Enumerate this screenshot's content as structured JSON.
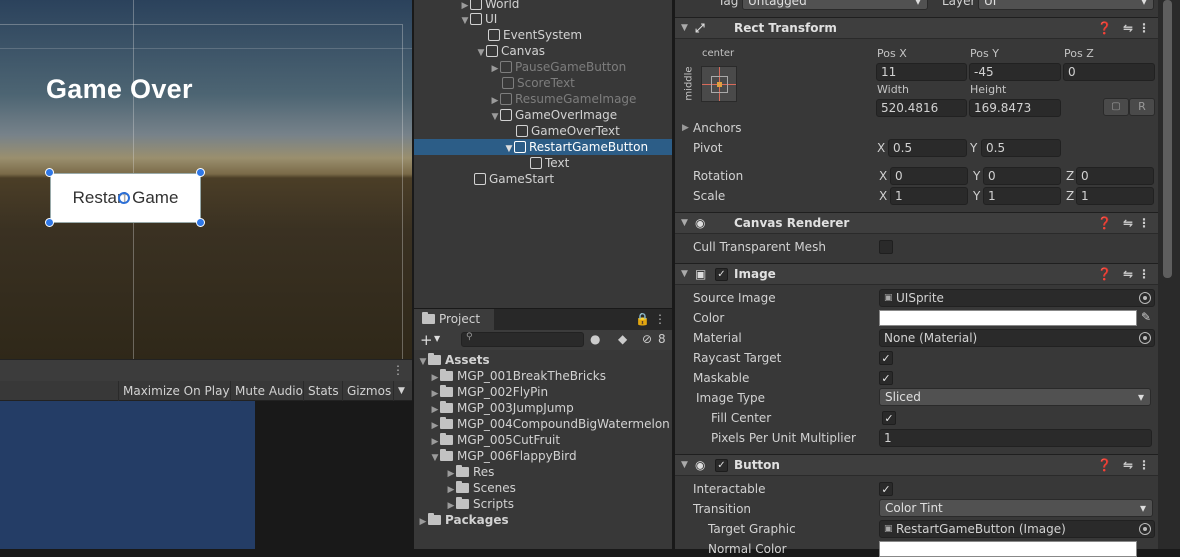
{
  "scene": {
    "title_text": "Game Over",
    "button_text": "Restart Game"
  },
  "game_toolbar": {
    "maximize_label": "Maximize On Play",
    "mute_label": "Mute Audio",
    "stats_label": "Stats",
    "gizmos_label": "Gizmos"
  },
  "hierarchy": {
    "items": [
      {
        "label": "World"
      },
      {
        "label": "UI"
      },
      {
        "label": "EventSystem"
      },
      {
        "label": "Canvas"
      },
      {
        "label": "PauseGameButton"
      },
      {
        "label": "ScoreText"
      },
      {
        "label": "ResumeGameImage"
      },
      {
        "label": "GameOverImage"
      },
      {
        "label": "GameOverText"
      },
      {
        "label": "RestartGameButton"
      },
      {
        "label": "Text"
      },
      {
        "label": "GameStart"
      }
    ]
  },
  "project": {
    "tab_label": "Project",
    "hidden_count": "8",
    "items": [
      {
        "label": "Assets"
      },
      {
        "label": "MGP_001BreakTheBricks"
      },
      {
        "label": "MGP_002FlyPin"
      },
      {
        "label": "MGP_003JumpJump"
      },
      {
        "label": "MGP_004CompoundBigWatermelon"
      },
      {
        "label": "MGP_005CutFruit"
      },
      {
        "label": "MGP_006FlappyBird"
      },
      {
        "label": "Res"
      },
      {
        "label": "Scenes"
      },
      {
        "label": "Scripts"
      },
      {
        "label": "Packages"
      }
    ]
  },
  "inspector": {
    "tag_label": "Tag",
    "tag_value": "Untagged",
    "layer_label": "Layer",
    "layer_value": "UI",
    "rect_transform": {
      "title": "Rect Transform",
      "anchor_h": "center",
      "anchor_v": "middle",
      "pos_x_label": "Pos X",
      "pos_x": "11",
      "pos_y_label": "Pos Y",
      "pos_y": "-45",
      "pos_z_label": "Pos Z",
      "pos_z": "0",
      "width_label": "Width",
      "width": "520.4816",
      "height_label": "Height",
      "height": "169.8473",
      "r_label": "R",
      "anchors_label": "Anchors",
      "pivot_label": "Pivot",
      "pivot_x": "0.5",
      "pivot_y": "0.5",
      "rotation_label": "Rotation",
      "rot_x": "0",
      "rot_y": "0",
      "rot_z": "0",
      "scale_label": "Scale",
      "scale_x": "1",
      "scale_y": "1",
      "scale_z": "1",
      "x": "X",
      "y": "Y",
      "z": "Z"
    },
    "canvas_renderer": {
      "title": "Canvas Renderer",
      "cull_label": "Cull Transparent Mesh"
    },
    "image": {
      "title": "Image",
      "source_label": "Source Image",
      "source_value": "UISprite",
      "color_label": "Color",
      "material_label": "Material",
      "material_value": "None (Material)",
      "raycast_label": "Raycast Target",
      "maskable_label": "Maskable",
      "type_label": "Image Type",
      "type_value": "Sliced",
      "fill_center_label": "Fill Center",
      "ppu_label": "Pixels Per Unit Multiplier",
      "ppu_value": "1"
    },
    "button": {
      "title": "Button",
      "interactable_label": "Interactable",
      "transition_label": "Transition",
      "transition_value": "Color Tint",
      "target_label": "Target Graphic",
      "target_value": "RestartGameButton (Image)",
      "normal_label": "Normal Color"
    }
  },
  "colors": {
    "selection": "#2c5d87",
    "panel": "#383838",
    "game_canvas": "#243d66"
  }
}
